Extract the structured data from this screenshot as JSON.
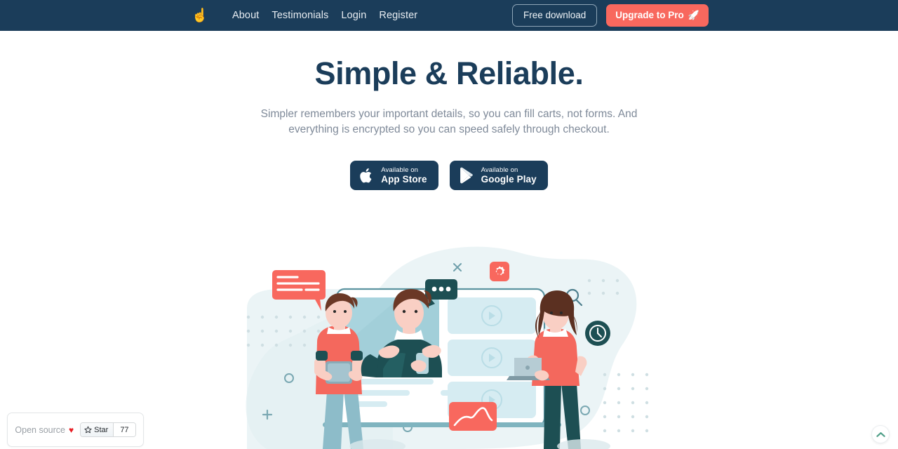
{
  "navbar": {
    "logo_icon": "pointing-hand-emoji",
    "logo_glyph": "☝",
    "links": [
      {
        "label": "About"
      },
      {
        "label": "Testimonials"
      },
      {
        "label": "Login"
      },
      {
        "label": "Register"
      }
    ],
    "free_download_label": "Free download",
    "upgrade_label": "Upgrade to Pro",
    "upgrade_icon": "rocket-icon",
    "upgrade_glyph": "🚀",
    "background_color": "#1b3d5a",
    "accent_color": "#f8685e"
  },
  "hero": {
    "headline": "Simple & Reliable.",
    "subtext": "Simpler remembers your important details, so you can fill carts, not forms. And everything is encrypted so you can speed safely through checkout.",
    "headline_color": "#1b3d5a",
    "subtext_color": "#7f8a99"
  },
  "store_badges": [
    {
      "icon": "apple-icon",
      "small_label": "Available on",
      "big_label": "App Store"
    },
    {
      "icon": "google-play-icon",
      "small_label": "Available on",
      "big_label": "Google Play"
    }
  ],
  "illustration": {
    "alt": "people-collaborating-with-devices-illustration",
    "blob_color": "#e8f2f4",
    "coral": "#f8685e",
    "teal": "#1d4f53",
    "light_blue": "#bfdde4"
  },
  "open_source_widget": {
    "label": "Open source",
    "heart_icon": "heart-icon",
    "heart_glyph": "♥",
    "star_icon": "star-icon",
    "star_label": "Star",
    "star_count": "77"
  },
  "scroll_top": {
    "icon": "chevron-up-icon",
    "color": "#4e9e87"
  }
}
